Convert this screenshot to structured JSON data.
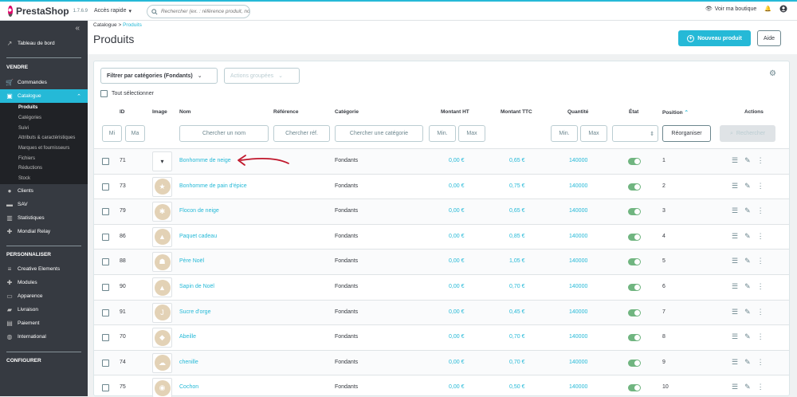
{
  "topbar": {
    "brand": "PrestaShop",
    "version": "1.7.6.9",
    "quick_access": "Accès rapide",
    "search_placeholder": "Rechercher (ex. : référence produit, no",
    "view_shop": "Voir ma boutique"
  },
  "sidebar": {
    "dashboard": "Tableau de bord",
    "section_sell": "VENDRE",
    "orders": "Commandes",
    "catalog": "Catalogue",
    "catalog_sub": [
      "Produits",
      "Catégories",
      "Suivi",
      "Attributs & caractéristiques",
      "Marques et fournisseurs",
      "Fichiers",
      "Réductions",
      "Stock"
    ],
    "clients": "Clients",
    "sav": "SAV",
    "stats": "Statistiques",
    "mondial": "Mondial Relay",
    "section_custom": "PERSONNALISER",
    "custom_items": [
      "Creative Elements",
      "Modules",
      "Apparence",
      "Livraison",
      "Paiement",
      "International"
    ],
    "section_config": "CONFIGURER"
  },
  "header": {
    "breadcrumb_parent": "Catalogue",
    "breadcrumb_sep": ">",
    "breadcrumb_current": "Produits",
    "title": "Produits",
    "new_product": "Nouveau produit",
    "help": "Aide"
  },
  "toolbar": {
    "filter_category": "Filtrer par catégories (Fondants)",
    "bulk_actions": "Actions groupées",
    "select_all": "Tout sélectionner"
  },
  "columns": {
    "id": "ID",
    "image": "Image",
    "name": "Nom",
    "reference": "Référence",
    "category": "Catégorie",
    "price_ht": "Montant HT",
    "price_ttc": "Montant TTC",
    "quantity": "Quantité",
    "state": "État",
    "position": "Position",
    "actions": "Actions"
  },
  "filters": {
    "id_min": "Mi",
    "id_max": "Ma",
    "name": "Chercher un nom",
    "reference": "Chercher réf.",
    "category": "Chercher une catégorie",
    "min": "Min.",
    "max": "Max",
    "qty_min": "Min.",
    "qty_max": "Max",
    "reorganize": "Réorganiser",
    "search": "Rechercher"
  },
  "products": [
    {
      "id": "71",
      "name": "Bonhomme de neige",
      "category": "Fondants",
      "ht": "0,00 €",
      "ttc": "0,65 €",
      "qty": "140000",
      "pos": "1"
    },
    {
      "id": "73",
      "name": "Bonhomme de pain d'épice",
      "category": "Fondants",
      "ht": "0,00 €",
      "ttc": "0,75 €",
      "qty": "140000",
      "pos": "2"
    },
    {
      "id": "79",
      "name": "Flocon de neige",
      "category": "Fondants",
      "ht": "0,00 €",
      "ttc": "0,65 €",
      "qty": "140000",
      "pos": "3"
    },
    {
      "id": "86",
      "name": "Paquet cadeau",
      "category": "Fondants",
      "ht": "0,00 €",
      "ttc": "0,85 €",
      "qty": "140000",
      "pos": "4"
    },
    {
      "id": "88",
      "name": "Père Noël",
      "category": "Fondants",
      "ht": "0,00 €",
      "ttc": "1,05 €",
      "qty": "140000",
      "pos": "5"
    },
    {
      "id": "90",
      "name": "Sapin de Noël",
      "category": "Fondants",
      "ht": "0,00 €",
      "ttc": "0,70 €",
      "qty": "140000",
      "pos": "6"
    },
    {
      "id": "91",
      "name": "Sucre d'orge",
      "category": "Fondants",
      "ht": "0,00 €",
      "ttc": "0,45 €",
      "qty": "140000",
      "pos": "7"
    },
    {
      "id": "70",
      "name": "Abeille",
      "category": "Fondants",
      "ht": "0,00 €",
      "ttc": "0,70 €",
      "qty": "140000",
      "pos": "8"
    },
    {
      "id": "74",
      "name": "chenille",
      "category": "Fondants",
      "ht": "0,00 €",
      "ttc": "0,70 €",
      "qty": "140000",
      "pos": "9"
    },
    {
      "id": "75",
      "name": "Cochon",
      "category": "Fondants",
      "ht": "0,00 €",
      "ttc": "0,50 €",
      "qty": "140000",
      "pos": "10"
    }
  ],
  "colors": {
    "accent": "#25b9d7",
    "sidebar": "#363a41",
    "toggle_on": "#70b580",
    "annotation": "#c0162b"
  }
}
